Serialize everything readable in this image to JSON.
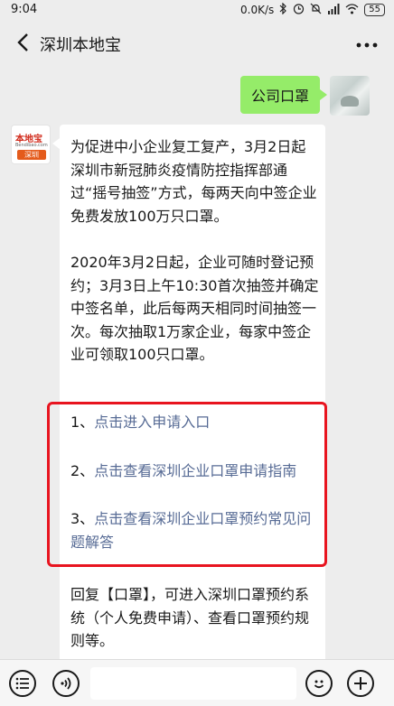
{
  "status_bar": {
    "time": "9:04",
    "network_speed": "0.0K/s",
    "battery": "55",
    "icons": [
      "bluetooth-icon",
      "alarm-icon",
      "mute-icon",
      "signal-icon",
      "wifi-icon",
      "battery-icon"
    ]
  },
  "nav": {
    "title": "深圳本地宝",
    "back_icon": "chevron-left-icon",
    "more_icon": "more-dots-icon"
  },
  "messages": {
    "outgoing": {
      "text": "公司口罩"
    },
    "incoming": {
      "sender_logo": {
        "top": "本地宝",
        "mid": "Bendibao.com",
        "bottom": "深圳"
      },
      "paragraph1": "为促进中小企业复工复产，3月2日起深圳市新冠肺炎疫情防控指挥部通过“摇号抽签”方式，每两天向中签企业免费发放100万只口罩。",
      "paragraph2": "2020年3月2日起，企业可随时登记预约；3月3日上午10:30首次抽签并确定中签名单，此后每两天相同时间抽签一次。每次抽取1万家企业，每家中签企业可领取100只口罩。",
      "links": [
        {
          "prefix": "1、",
          "text": "点击进入申请入口"
        },
        {
          "prefix": "2、",
          "text": "点击查看深圳企业口罩申请指南"
        },
        {
          "prefix": "3、",
          "text": "点击查看深圳企业口罩预约常见问题解答"
        }
      ],
      "paragraph3": "回复【口罩】，可进入深圳口罩预约系统（个人免费申请）、查看口罩预约规则等。"
    }
  },
  "input_bar": {
    "menu_icon": "menu-list-icon",
    "voice_icon": "voice-icon",
    "emoji_icon": "emoji-icon",
    "plus_icon": "plus-icon"
  },
  "colors": {
    "outgoing_bubble": "#95ec69",
    "link": "#576b95",
    "highlight_box": "#e8141f"
  }
}
